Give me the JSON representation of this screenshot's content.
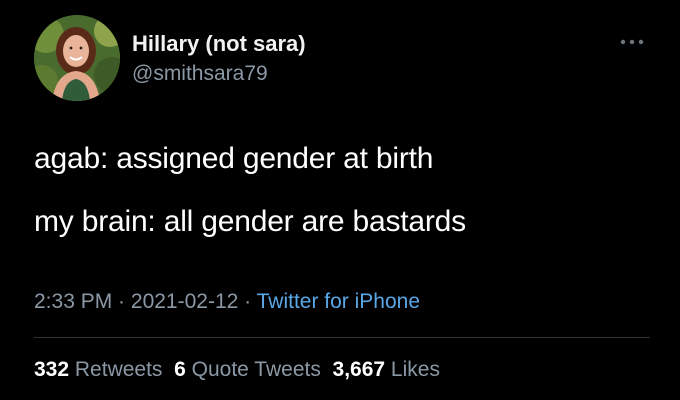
{
  "user": {
    "display_name": "Hillary (not sara)",
    "handle": "@smithsara79"
  },
  "tweet": {
    "line1": "agab: assigned gender at birth",
    "line2": "my brain: all gender are bastards"
  },
  "meta": {
    "time": "2:33 PM",
    "sep1": " · ",
    "date": "2021-02-12",
    "sep2": " · ",
    "source": "Twitter for iPhone"
  },
  "stats": {
    "retweets_count": "332",
    "retweets_label": "Retweets",
    "quotes_count": "6",
    "quotes_label": "Quote Tweets",
    "likes_count": "3,667",
    "likes_label": "Likes"
  },
  "icons": {
    "more": "more-horizontal-icon"
  },
  "colors": {
    "background": "#000000",
    "primary_text": "#ffffff",
    "secondary_text": "#8b98a5",
    "link": "#5aa7e6",
    "divider": "#2f3336"
  }
}
